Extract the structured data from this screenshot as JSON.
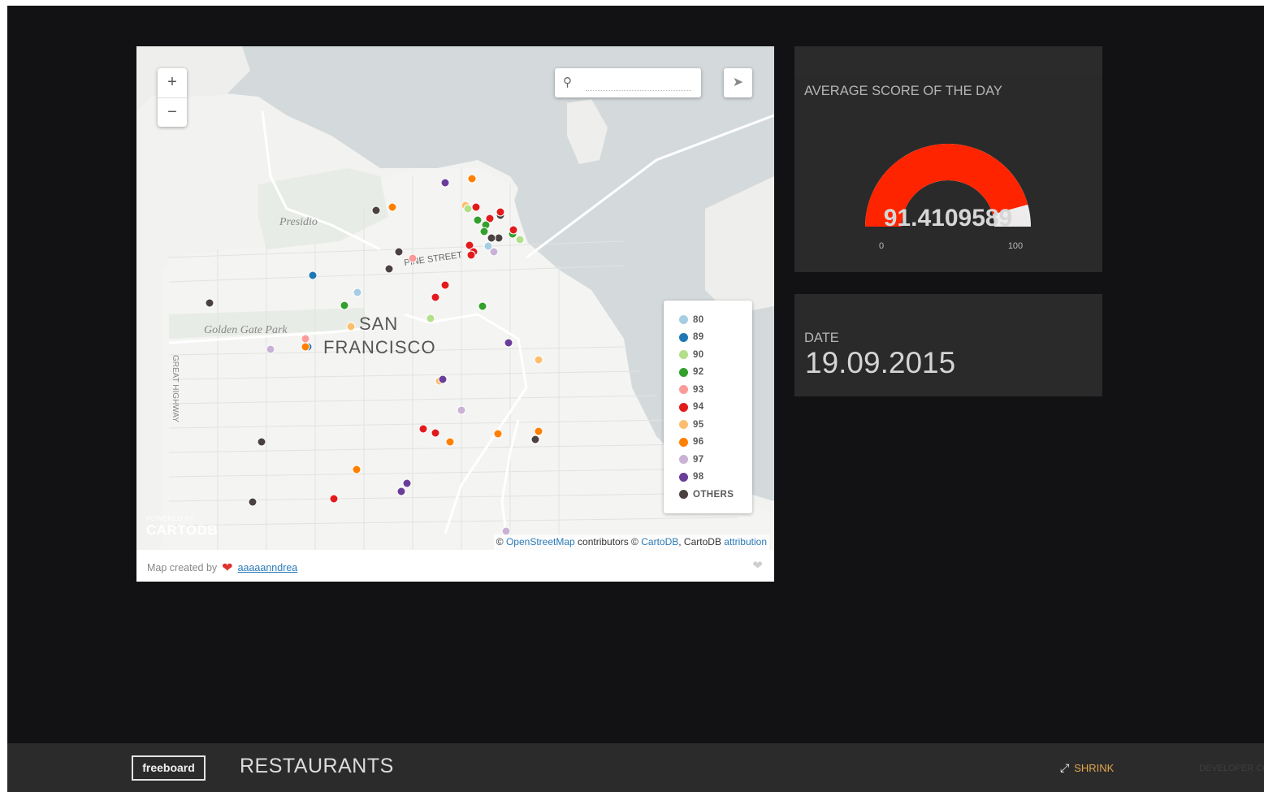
{
  "map": {
    "zoom_in_label": "+",
    "zoom_out_label": "−",
    "search_placeholder": "",
    "labels": {
      "presidio": "Presidio",
      "golden_gate_park": "Golden Gate Park",
      "sf_line1": "SAN",
      "sf_line2": "FRANCISCO",
      "pine_street": "PINE STREET",
      "great_highway": "GREAT HIGHWAY"
    },
    "legend": [
      {
        "label": "80",
        "color": "#a6cee3"
      },
      {
        "label": "89",
        "color": "#1f78b4"
      },
      {
        "label": "90",
        "color": "#b2df8a"
      },
      {
        "label": "92",
        "color": "#33a02c"
      },
      {
        "label": "93",
        "color": "#fb9a99"
      },
      {
        "label": "94",
        "color": "#e31a1c"
      },
      {
        "label": "95",
        "color": "#fdbf6f"
      },
      {
        "label": "96",
        "color": "#ff7f00"
      },
      {
        "label": "97",
        "color": "#cab2d6"
      },
      {
        "label": "98",
        "color": "#6a3d9a"
      },
      {
        "label": "OTHERS",
        "color": "#4b4141"
      }
    ],
    "attribution": {
      "prefix": "©",
      "osm_link": "OpenStreetMap",
      "contributors": "contributors ©",
      "cartodb_link": "CartoDB",
      "separator": ", CartoDB",
      "attribution_link": "attribution"
    },
    "logo": {
      "powered_by": "POWERED BY",
      "name": "CARTODB"
    },
    "footer": {
      "created_by": "Map created by",
      "author": "aaaaanndrea"
    }
  },
  "gauge_widget": {
    "title": "AVERAGE SCORE OF THE DAY",
    "value": 91.4109589,
    "display_value": "91.4109589",
    "min": "0",
    "max": "100",
    "fill_color": "#ff2400",
    "track_color": "#edebeb"
  },
  "date_widget": {
    "title": "DATE",
    "value": "19.09.2015"
  },
  "footer": {
    "logo": "freeboard",
    "dashboard_title": "RESTAURANTS",
    "shrink_label": "SHRINK",
    "developer_console": "DEVELOPER CONSOLE"
  }
}
